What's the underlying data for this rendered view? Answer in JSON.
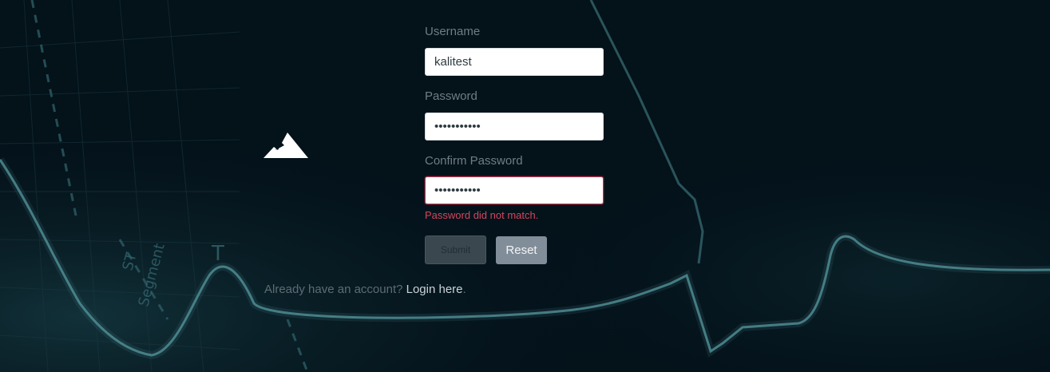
{
  "form": {
    "username_label": "Username",
    "username_value": "kalitest",
    "password_label": "Password",
    "password_value": "password123",
    "confirm_label": "Confirm Password",
    "confirm_value": "password123",
    "error_message": "Password did not match.",
    "submit_label": "Submit",
    "reset_label": "Reset"
  },
  "footer": {
    "prompt": "Already have an account?",
    "login_link": "Login here",
    "period": "."
  },
  "logo": {
    "icon": "mountain-icon",
    "color": "#ffffff"
  },
  "colors": {
    "background": "#04121a",
    "error": "#d2465d",
    "reset_button": "#818e99",
    "submit_button": "#3b474e"
  }
}
